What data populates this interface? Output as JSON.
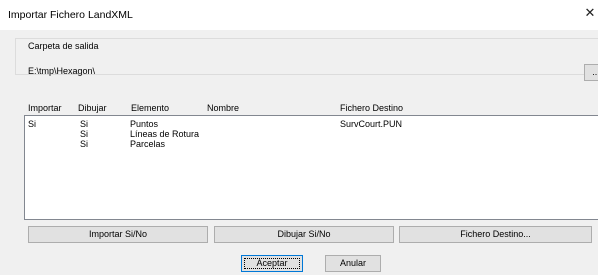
{
  "window": {
    "title": "Importar Fichero LandXML",
    "close_symbol": "✕"
  },
  "output_group": {
    "legend": "Carpeta de salida",
    "path": "E:\\tmp\\Hexagon\\",
    "browse_label": "..."
  },
  "columns": [
    "Importar",
    "Dibujar",
    "Elemento",
    "Nombre",
    "Fichero Destino"
  ],
  "rows": [
    {
      "importar": "Si",
      "dibujar": "Si",
      "elemento": "Puntos",
      "nombre": "",
      "fichero": "SurvCourt.PUN"
    },
    {
      "importar": "",
      "dibujar": "Si",
      "elemento": "Líneas de Rotura",
      "nombre": "",
      "fichero": ""
    },
    {
      "importar": "",
      "dibujar": "Si",
      "elemento": "Parcelas",
      "nombre": "",
      "fichero": ""
    }
  ],
  "buttons": {
    "importar": "Importar Si/No",
    "dibujar": "Dibujar Si/No",
    "fichero": "Fichero Destino...",
    "aceptar": "Aceptar",
    "anular": "Anular"
  }
}
